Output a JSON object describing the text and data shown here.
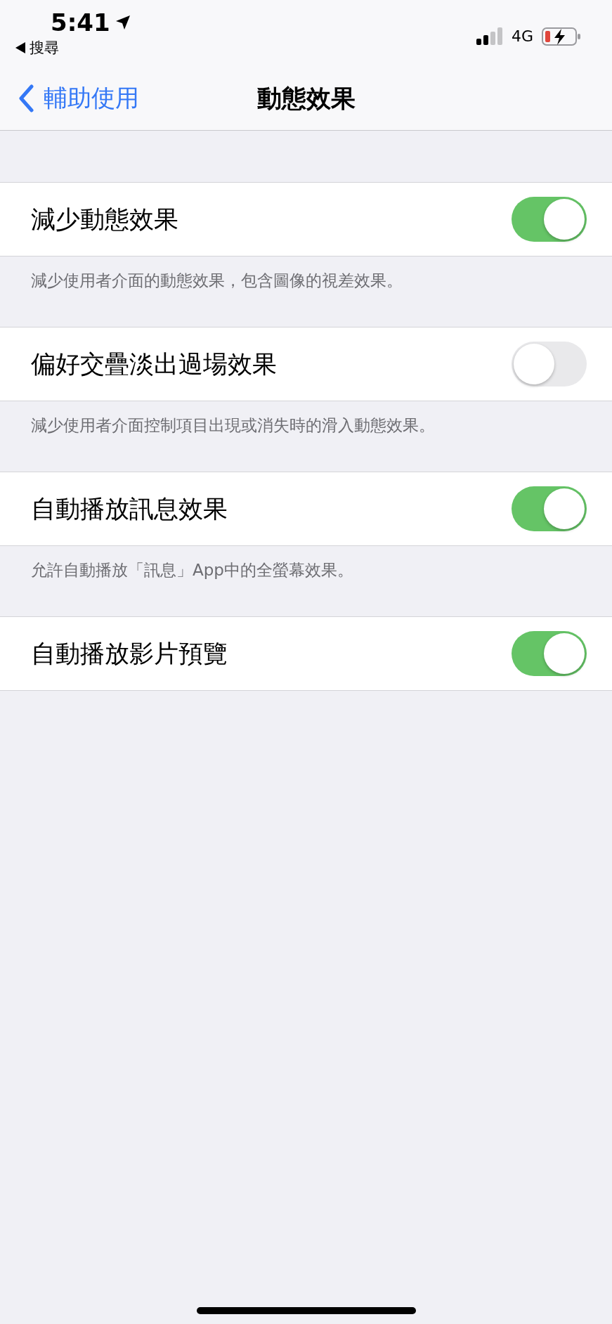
{
  "status_bar": {
    "time": "5:41",
    "back_app": "搜尋",
    "network": "4G"
  },
  "nav": {
    "back": "輔助使用",
    "title": "動態效果"
  },
  "settings": [
    {
      "label": "減少動態效果",
      "on": true,
      "footer": "減少使用者介面的動態效果，包含圖像的視差效果。"
    },
    {
      "label": "偏好交疊淡出過場效果",
      "on": false,
      "footer": "減少使用者介面控制項目出現或消失時的滑入動態效果。"
    },
    {
      "label": "自動播放訊息效果",
      "on": true,
      "footer": "允許自動播放「訊息」App中的全螢幕效果。"
    },
    {
      "label": "自動播放影片預覽",
      "on": true
    }
  ]
}
